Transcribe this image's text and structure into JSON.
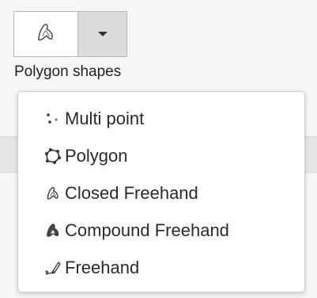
{
  "tool": {
    "main_icon": "closed-freehand-icon",
    "toggle_icon": "caret-down-icon",
    "caption": "Polygon shapes"
  },
  "menu": {
    "items": [
      {
        "label": "Multi point",
        "icon": "multipoint-icon"
      },
      {
        "label": "Polygon",
        "icon": "polygon-icon"
      },
      {
        "label": "Closed Freehand",
        "icon": "closed-freehand-icon"
      },
      {
        "label": "Compound Freehand",
        "icon": "compound-freehand-icon"
      },
      {
        "label": "Freehand",
        "icon": "freehand-icon"
      }
    ]
  },
  "colors": {
    "icon_stroke": "#555555",
    "toggle_bg": "#dcdcdc",
    "page_bg": "#f6f6f6"
  }
}
